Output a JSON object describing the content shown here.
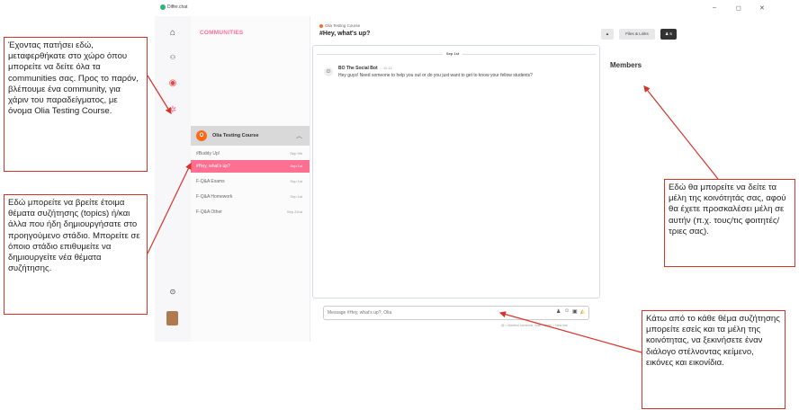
{
  "window": {
    "app_title": "Differ.chat",
    "minimize": "–",
    "maximize": "◻",
    "close": "✕"
  },
  "sidebar": {
    "title": "COMMUNITIES",
    "community": {
      "initial": "O",
      "name": "Olia Testing Course",
      "collapse": "︿"
    },
    "topics": [
      {
        "name": "#Buddy Up!",
        "date": "Sep 9th",
        "active": false
      },
      {
        "name": "#Hey, what's up?",
        "date": "Sep 1st",
        "active": true
      },
      {
        "name": "F-Q&A Exams",
        "date": "Sep 1st",
        "active": false
      },
      {
        "name": "F-Q&A Homework",
        "date": "Sep 1st",
        "active": false
      },
      {
        "name": "F-Q&A Other",
        "date": "Sep 22nd",
        "active": false
      }
    ]
  },
  "chat": {
    "course": "Olia Testing Course",
    "topic": "#Hey, what's up?",
    "day_divider": "Sep 1st",
    "message": {
      "author": "BO The Social Bot",
      "time": "11:12",
      "text": "Hey guys! Need someone to help you out or do you just want to get to know your fellow students?"
    },
    "input_placeholder": "Message #Hey, what's up?, Olia",
    "hint": "@ = Mention someone, Shift + enter = New line"
  },
  "toolbar": {
    "files_label": "Files & Links",
    "members_count": "6"
  },
  "members": {
    "title": "Members"
  },
  "annotations": {
    "communities_note": "Έχοντας πατήσει εδώ, μεταφερθήκατε στο χώρο όπου μπορείτε να δείτε όλα τα communities σας. Προς το παρόν, βλέπουμε ένα community, για χάριν του παραδείγματος, με όνομα Olia Testing Course.",
    "topics_note": "Εδώ μπορείτε να βρείτε έτοιμα θέματα συζήτησης (topics) ή/και άλλα που ήδη δημιουργήσατε στο προηγούμενο στάδιο. Μπορείτε σε όποιο στάδιο επιθυμείτε να δημιουργείτε νέα θέματα συζήτησης.",
    "members_note": "Εδώ θα μπορείτε να δείτε τα μέλη της κοινότητάς σας, αφού θα έχετε προσκαλέσει μέλη σε αυτήν (π.χ. τους/τις φοιτητές/τριες σας).",
    "input_note": "Κάτω από το κάθε θέμα συζήτησης μπορείτε εσείς και τα μέλη της κοινότητας, να ξεκινήσετε έναν διάλογο στέλνοντας κείμενο, εικόνες και εικονίδια."
  },
  "colors": {
    "accent": "#ff6f91",
    "community": "#ff6a1a",
    "annotation": "#d6332b"
  }
}
